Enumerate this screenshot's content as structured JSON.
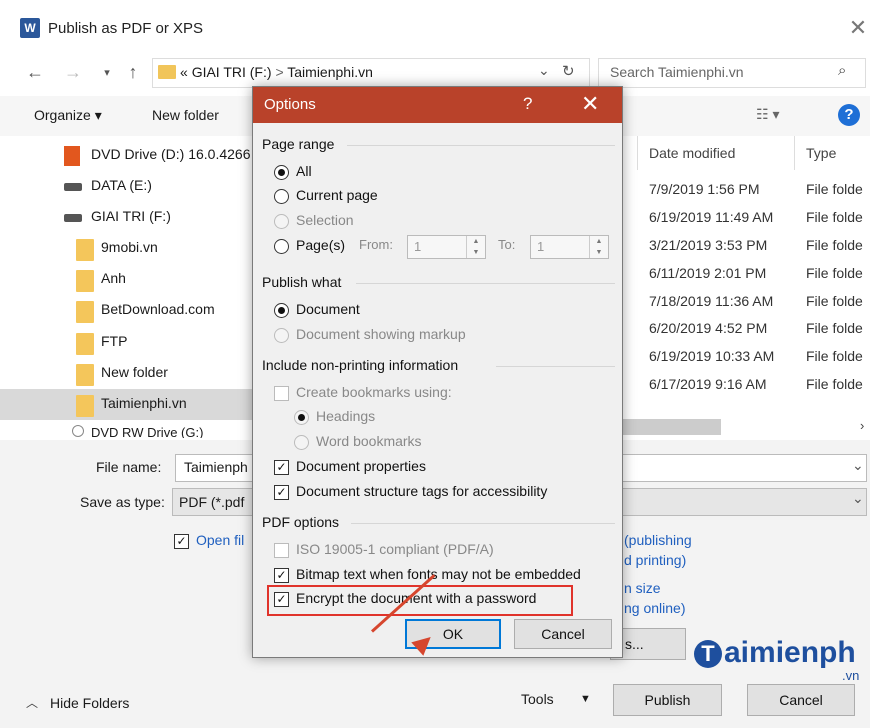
{
  "window": {
    "title": "Publish as PDF or XPS",
    "app_icon": "W"
  },
  "nav": {
    "path_prefix": "«",
    "path_drive": "GIAI TRI (F:)",
    "path_sep": ">",
    "path_folder": "Taimienphi.vn",
    "search_placeholder": "Search Taimienphi.vn"
  },
  "toolbar": {
    "organize": "Organize ▾",
    "new_folder": "New folder"
  },
  "sidebar": {
    "items": [
      {
        "label": "DVD Drive (D:) 16.0.4266"
      },
      {
        "label": "DATA (E:)"
      },
      {
        "label": "GIAI TRI (F:)"
      },
      {
        "label": "9mobi.vn"
      },
      {
        "label": "Anh"
      },
      {
        "label": "BetDownload.com"
      },
      {
        "label": "FTP"
      },
      {
        "label": "New folder"
      },
      {
        "label": "Taimienphi.vn"
      },
      {
        "label": "DVD RW Drive (G:)"
      }
    ]
  },
  "columns": {
    "date_modified": "Date modified",
    "type": "Type"
  },
  "files": [
    {
      "date": "7/9/2019 1:56 PM",
      "type": "File folde"
    },
    {
      "date": "6/19/2019 11:49 AM",
      "type": "File folde"
    },
    {
      "date": "3/21/2019 3:53 PM",
      "type": "File folde"
    },
    {
      "date": "6/11/2019 2:01 PM",
      "type": "File folde"
    },
    {
      "date": "7/18/2019 11:36 AM",
      "type": "File folde"
    },
    {
      "date": "6/20/2019 4:52 PM",
      "type": "File folde"
    },
    {
      "date": "6/19/2019 10:33 AM",
      "type": "File folde"
    },
    {
      "date": "6/17/2019 9:16 AM",
      "type": "File folde"
    }
  ],
  "form": {
    "file_name_label": "File name:",
    "file_name_value": "Taimienph",
    "save_type_label": "Save as type:",
    "save_type_value": "PDF (*.pdf",
    "open_file_label": "Open fil",
    "publishing_text": "(publishing",
    "printing_text": "d printing)",
    "size_text": "n size",
    "online_text": "ng online)",
    "options_stub": "s..."
  },
  "footer": {
    "hide_folders": "Hide Folders",
    "tools": "Tools",
    "publish": "Publish",
    "cancel": "Cancel"
  },
  "watermark": {
    "logo_letter": "T",
    "text": "aimienph",
    "sub": ".vn"
  },
  "dialog": {
    "title": "Options",
    "help": "?",
    "close": "✕",
    "page_range": {
      "heading": "Page range",
      "all": "All",
      "current_page": "Current page",
      "selection": "Selection",
      "pages": "Page(s)",
      "from_label": "From:",
      "from_value": "1",
      "to_label": "To:",
      "to_value": "1"
    },
    "publish_what": {
      "heading": "Publish what",
      "document": "Document",
      "document_markup": "Document showing markup"
    },
    "non_printing": {
      "heading": "Include non-printing information",
      "create_bookmarks": "Create bookmarks using:",
      "headings": "Headings",
      "word_bookmarks": "Word bookmarks",
      "doc_properties": "Document properties",
      "doc_structure": "Document structure tags for accessibility"
    },
    "pdf_options": {
      "heading": "PDF options",
      "iso": "ISO 19005-1 compliant (PDF/A)",
      "bitmap": "Bitmap text when fonts may not be embedded",
      "encrypt": "Encrypt the document with a password"
    },
    "ok": "OK",
    "cancel": "Cancel"
  },
  "colors": {
    "dialog_title": "#b9422a",
    "highlight": "#e0332b",
    "arrow": "#d6462e",
    "link": "#1f5fbf"
  }
}
